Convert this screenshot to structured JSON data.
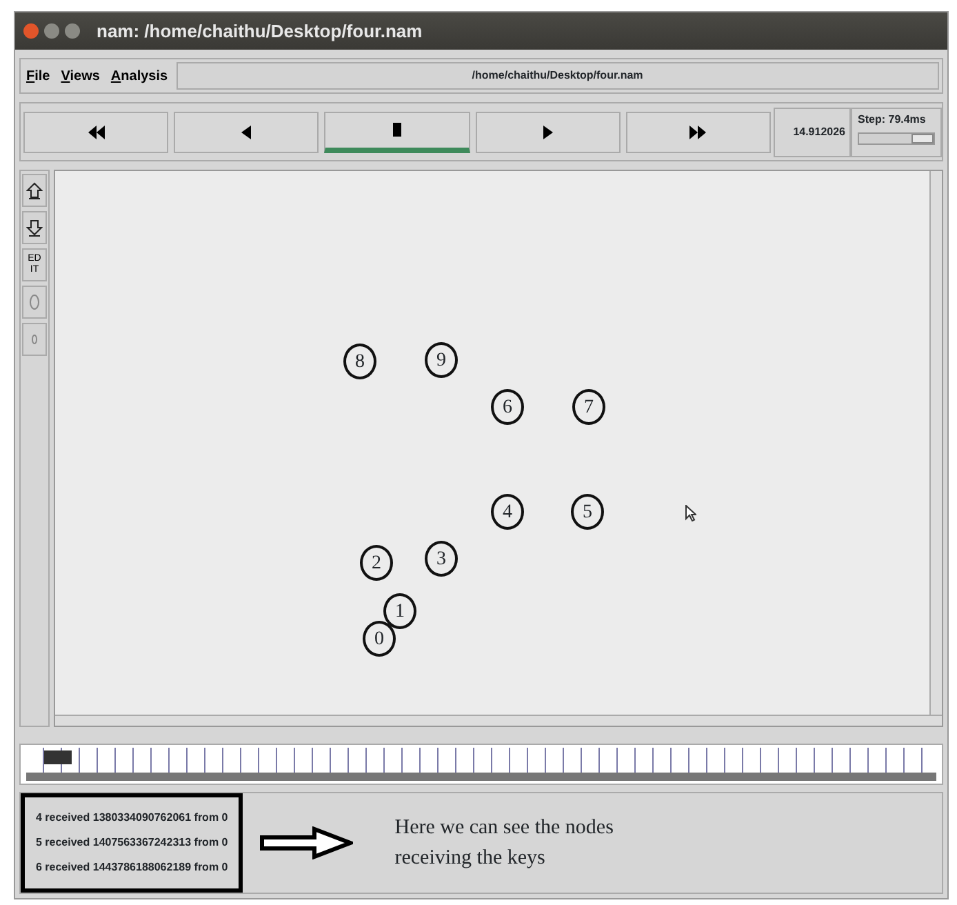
{
  "window": {
    "title": "nam: /home/chaithu/Desktop/four.nam"
  },
  "menu": [
    {
      "label": "File",
      "underline_first": true
    },
    {
      "label": "Views",
      "underline_first": true
    },
    {
      "label": "Analysis",
      "underline_first": true
    }
  ],
  "file_path": "/home/chaithu/Desktop/four.nam",
  "transport": [
    {
      "kind": "rewind",
      "selected": false
    },
    {
      "kind": "back",
      "selected": false
    },
    {
      "kind": "stop",
      "selected": true
    },
    {
      "kind": "play",
      "selected": false
    },
    {
      "kind": "forward",
      "selected": false
    }
  ],
  "time": "14.912026",
  "step": {
    "label": "Step: 79.4ms",
    "level": 0.85
  },
  "tools": [
    {
      "kind": "zoom-in"
    },
    {
      "kind": "zoom-out"
    },
    {
      "kind": "edit",
      "label": "ED IT"
    },
    {
      "kind": "oval"
    },
    {
      "kind": "small-oval"
    }
  ],
  "nodes": [
    {
      "label": "8"
    },
    {
      "label": "9"
    },
    {
      "label": "6"
    },
    {
      "label": "7"
    },
    {
      "label": "4"
    },
    {
      "label": "5"
    },
    {
      "label": "2"
    },
    {
      "label": "3"
    },
    {
      "label": "1"
    },
    {
      "label": "0"
    }
  ],
  "timeline": {
    "level": 0.02
  },
  "log": [
    "4 received 1380334090762061 from 0",
    "5 received 1407563367242313 from 0",
    "6 received 1443786188062189 from 0"
  ],
  "annotation": "Here we can see the nodes receiving the keys"
}
